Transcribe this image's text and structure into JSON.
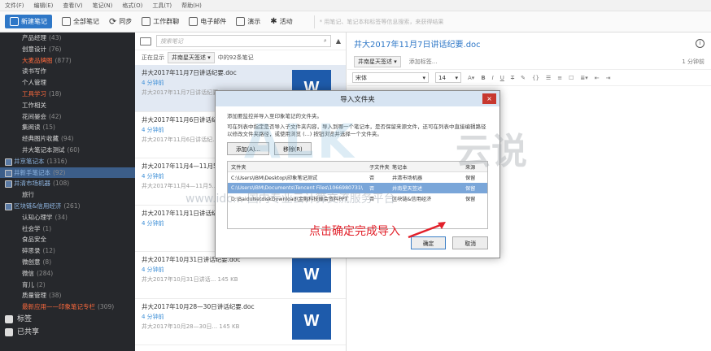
{
  "menubar": [
    "文件(F)",
    "编辑(E)",
    "查看(V)",
    "笔记(N)",
    "格式(O)",
    "工具(T)",
    "帮助(H)"
  ],
  "toolbar": {
    "new_note": "新建笔记",
    "all_notes": "全部笔记",
    "sync": "同步",
    "work_chat": "工作群聊",
    "email": "电子邮件",
    "present": "演示",
    "activity": "活动",
    "search_placeholder": "* 用笔记、笔记本和标签等信息搜索，来获得结果"
  },
  "sidebar": {
    "notebooks": [
      {
        "name": "产品经理",
        "count": "(43)",
        "style": "normal"
      },
      {
        "name": "创意设计",
        "count": "(76)",
        "style": "normal"
      },
      {
        "name": "大麦品牌图",
        "count": "(877)",
        "style": "hl"
      },
      {
        "name": "读书写作",
        "count": "",
        "style": "normal"
      },
      {
        "name": "个人管理",
        "count": "",
        "style": "normal"
      },
      {
        "name": "工具学习",
        "count": "(18)",
        "style": "hl"
      },
      {
        "name": "工作相关",
        "count": "",
        "style": "normal"
      },
      {
        "name": "花间晏会",
        "count": "(42)",
        "style": "normal"
      },
      {
        "name": "集阅读",
        "count": "(15)",
        "style": "normal"
      },
      {
        "name": "经典图片收藏",
        "count": "(94)",
        "style": "normal"
      },
      {
        "name": "井大笔记本测试",
        "count": "(60)",
        "style": "normal"
      },
      {
        "name": "井京笔记本",
        "count": "(1316)",
        "style": "stack"
      },
      {
        "name": "井新手笔记本",
        "count": "(92)",
        "style": "sel"
      },
      {
        "name": "井清市场机器",
        "count": "(108)",
        "style": "stack"
      },
      {
        "name": "旅行",
        "count": "",
        "style": "normal"
      },
      {
        "name": "区块链&信用经济",
        "count": "(261)",
        "style": "stack"
      },
      {
        "name": "认知心理学",
        "count": "(34)",
        "style": "normal"
      },
      {
        "name": "社会学",
        "count": "(1)",
        "style": "normal"
      },
      {
        "name": "食品安全",
        "count": "",
        "style": "normal"
      },
      {
        "name": "碎思录",
        "count": "(12)",
        "style": "normal"
      },
      {
        "name": "微创意",
        "count": "(8)",
        "style": "normal"
      },
      {
        "name": "微信",
        "count": "(284)",
        "style": "normal"
      },
      {
        "name": "育儿",
        "count": "(2)",
        "style": "normal"
      },
      {
        "name": "质量管理",
        "count": "(38)",
        "style": "normal"
      },
      {
        "name": "最新应用——印象笔记专栏",
        "count": "(309)",
        "style": "hl"
      }
    ],
    "tags_label": "标签",
    "shared_label": "已共享"
  },
  "list": {
    "search_placeholder": "搜索笔记",
    "showing": "正在显示",
    "notebook": "井南星天签述",
    "count_text": "中的92条笔记",
    "notes": [
      {
        "title": "井大2017年11月7日讲话纪要.doc",
        "ago": "4 分钟前",
        "meta": "井大2017年11月7日讲话纪要...",
        "thumb": "W",
        "selected": true
      },
      {
        "title": "井大2017年11月6日讲话纪",
        "ago": "4 分钟前",
        "meta": "井大2017年11月6日讲话纪...",
        "thumb": "W",
        "selected": false
      },
      {
        "title": "井大2017年11月4—11月5日讲话纪要.doc",
        "ago": "4 分钟前",
        "meta": "井大2017年11月4—11月5...",
        "thumb": "W",
        "selected": false
      },
      {
        "title": "井大2017年11月1日讲话纪要.doc",
        "ago": "4 分钟前",
        "meta": "",
        "thumb": "W",
        "selected": false
      },
      {
        "title": "井大2017年10月31日讲话纪要.doc",
        "ago": "4 分钟前",
        "meta": "井大2017年10月31日讲话...   145 KB",
        "thumb": "W",
        "selected": false
      },
      {
        "title": "井大2017年10月28—30日讲话纪要.doc",
        "ago": "4 分钟前",
        "meta": "井大2017年10月28—30日...   145 KB",
        "thumb": "W",
        "selected": false
      }
    ]
  },
  "editor": {
    "title": "井大2017年11月7日讲话纪要.doc",
    "notebook": "井南星天签述",
    "add_tag": "添加标签...",
    "modified": "1 分钟前",
    "font": "宋体",
    "size": "14"
  },
  "dialog": {
    "title": "导入文件夹",
    "close": "×",
    "line1": "添加要监控并导入至印象笔记的文件夹。",
    "line2": "可在列表中指定是否导入子文件夹内容，导入到哪一个笔记本，是否保留来源文件，还可在列表中直接编辑路径以修改文件夹路径，或使用浏览 (...) 按钮浏览并选择一个文件夹。",
    "add_btn": "添加(A)...",
    "remove_btn": "移除(R)",
    "headers": [
      "文件夹",
      "子文件夹",
      "笔记本",
      "来源"
    ],
    "rows": [
      {
        "folder": "C:\\Users\\IBM\\Desktop\\印象笔记测试",
        "sub": "否",
        "notebook": "井清市场机器",
        "source": "保留",
        "selected": false
      },
      {
        "folder": "C:\\Users\\IBM\\Documents\\Tencent Files\\1066980731\\",
        "sub": "否",
        "notebook": "井南星天签述",
        "source": "保留",
        "selected": true
      },
      {
        "folder": "D:\\BaiduNetdiskDownload\\金融科技峰会资料PPT",
        "sub": "否",
        "notebook": "区块链&信用经济",
        "source": "保留",
        "selected": false
      }
    ],
    "ok": "确定",
    "cancel": "取消"
  },
  "annotation": "点击确定完成导入",
  "watermark": {
    "logo": "ALK",
    "brand": "云说",
    "url": "www.idc... 国内专业云计算交流服务平台-"
  }
}
